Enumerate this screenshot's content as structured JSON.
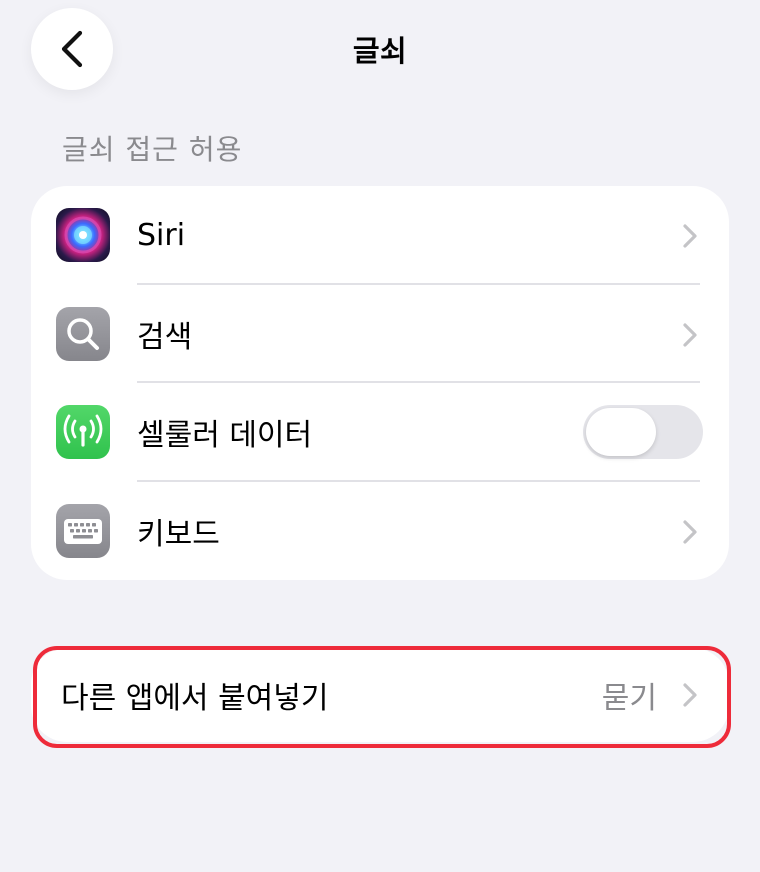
{
  "nav": {
    "title": "글쇠",
    "back_icon": "chevron-left-icon"
  },
  "section": {
    "header": "글쇠 접근 허용"
  },
  "rows": [
    {
      "label": "Siri",
      "icon": "siri-icon",
      "accessory": "chevron"
    },
    {
      "label": "검색",
      "icon": "magnifying-glass-icon",
      "accessory": "chevron"
    },
    {
      "label": "셀룰러 데이터",
      "icon": "cellular-antenna-icon",
      "accessory": "toggle",
      "toggle_on": false
    },
    {
      "label": "키보드",
      "icon": "keyboard-icon",
      "accessory": "chevron"
    }
  ],
  "paste": {
    "label": "다른 앱에서 붙여넣기",
    "value": "묻기"
  },
  "colors": {
    "background": "#f2f2f7",
    "card": "#ffffff",
    "secondary_text": "#8a8a8e",
    "highlight": "#ee2b3a",
    "cellular_green": "#34c759"
  }
}
